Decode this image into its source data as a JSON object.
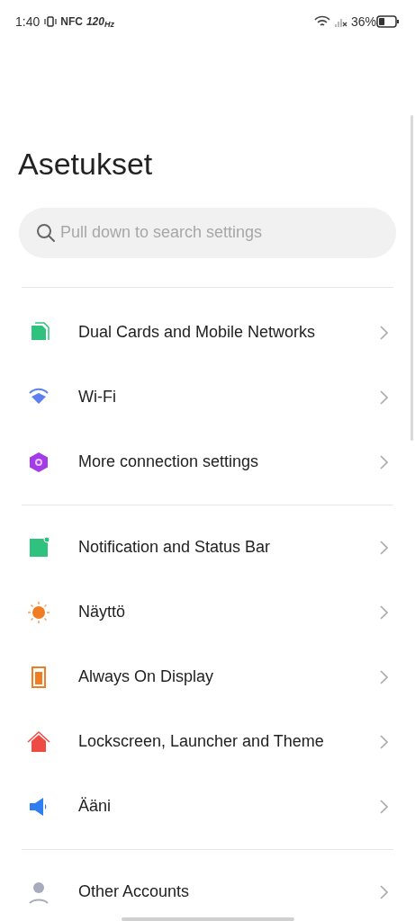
{
  "status_bar": {
    "time": "1:40",
    "nfc": "NFC",
    "refresh_rate": "120$_{Hz}$",
    "battery": "36%"
  },
  "title": "Asetukset",
  "search": {
    "placeholder": "Pull down to search settings"
  },
  "groups": [
    {
      "items": [
        {
          "label": "Dual Cards and Mobile Networks"
        },
        {
          "label": "Wi-Fi"
        },
        {
          "label": "More connection settings"
        }
      ]
    },
    {
      "items": [
        {
          "label": "Notification and Status Bar"
        },
        {
          "label": "Näyttö"
        },
        {
          "label": "Always On Display"
        },
        {
          "label": "Lockscreen, Launcher and Theme"
        },
        {
          "label": "Ääni"
        }
      ]
    },
    {
      "items": [
        {
          "label": "Other Accounts"
        }
      ]
    }
  ]
}
